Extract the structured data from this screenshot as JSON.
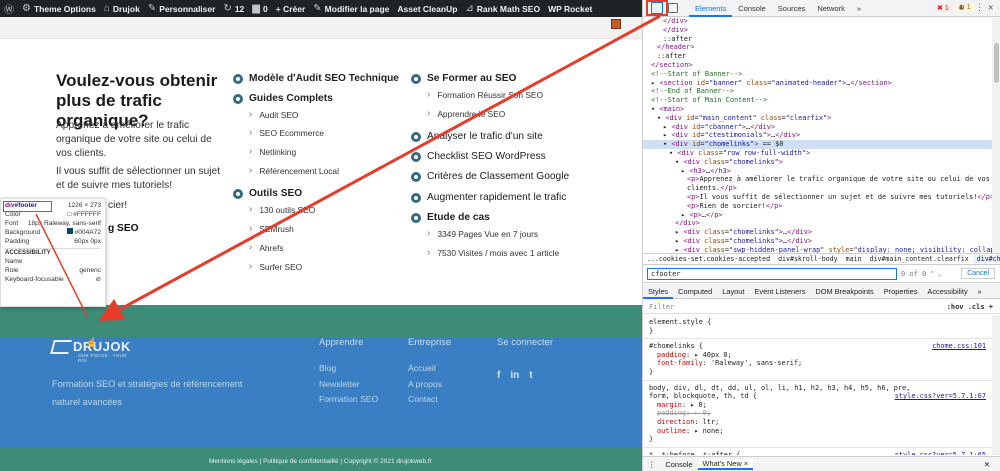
{
  "adminbar": {
    "items": [
      "Theme Options",
      "Drujok",
      "Personnaliser",
      "12",
      "0",
      "+ Créer",
      "Modifier la page",
      "Asset CleanUp",
      "Rank Math SEO",
      "WP Rocket"
    ]
  },
  "hero": {
    "title": "Voulez-vous obtenir plus de trafic organique?",
    "p1": "Apprenez à améliorer le trafic organique de votre site ou celui de vos clients.",
    "p2": "Il vous suffit de sélectionner un sujet et de suivre mes tutoriels!",
    "p3": "cier!",
    "p4": "g SEO"
  },
  "col1": {
    "b1": "Modèle d'Audit SEO Technique",
    "b2": "Guides Complets",
    "subs": [
      "Audit SEO",
      "SEO Ecommerce",
      "Netlinking",
      "Référencement Local"
    ],
    "b3": "Outils SEO",
    "subs2": [
      "130 outils SEO",
      "SEMrush",
      "Ahrefs",
      "Surfer SEO"
    ]
  },
  "col2": {
    "b1": "Se Former au SEO",
    "subs": [
      "Formation Réussir Son SEO",
      "Apprendre le SEO"
    ],
    "b2": "Analyser le trafic d'un site",
    "b3": "Checklist SEO WordPress",
    "b4": "Critères de Classement Google",
    "b5": "Augmenter rapidement le trafic",
    "b6": "Etude de cas",
    "subs2": [
      "3349 Pages Vue en 7 jours",
      "7530 Visites / mois avec 1 article"
    ]
  },
  "tooltip": {
    "selector_tag": "div",
    "selector_id": "#footer",
    "size": "1226 × 273",
    "rows": [
      {
        "k": "Color",
        "v": "#FFFFFF"
      },
      {
        "k": "Font",
        "v": "18px Raleway, sans-serif"
      },
      {
        "k": "Background",
        "v": "#004A72"
      },
      {
        "k": "Padding",
        "v": "60px 0px"
      }
    ],
    "section": "ACCESSIBILITY",
    "rows2": [
      {
        "k": "Name",
        "v": ""
      },
      {
        "k": "Role",
        "v": "generic"
      },
      {
        "k": "Keyboard-focusable",
        "v": "⊘"
      }
    ]
  },
  "footer": {
    "logo": "DRUJOK",
    "tagline": "OUR FOCUS · YOUR ROI",
    "desc1": "Formation SEO et stratégies de référencement",
    "desc2": "naturel avancées",
    "h_apprendre": "Apprendre",
    "apprendre": [
      "Blog",
      "Newsletter",
      "Formation SEO"
    ],
    "h_entreprise": "Entreprise",
    "entreprise": [
      "Accueil",
      "A propos",
      "Contact"
    ],
    "h_connect": "Se connecter",
    "socials": [
      "f",
      "in",
      "t"
    ],
    "legal": "Mentions légales  |  Politique de confidentialité  |  Copyright © 2021 drujokweb.fr"
  },
  "devtools": {
    "tabs": [
      "Elements",
      "Console",
      "Sources",
      "Network",
      "»"
    ],
    "errors": "1",
    "warnings": "1",
    "dom": [
      {
        "i": 20,
        "h": "<span class='tag'>&lt;/div&gt;</span>"
      },
      {
        "i": 20,
        "h": "<span class='tag'>&lt;/div&gt;</span>"
      },
      {
        "i": 20,
        "h": "::after"
      },
      {
        "i": 14,
        "h": "<span class='tag'>&lt;/header&gt;</span>"
      },
      {
        "i": 14,
        "h": "::after"
      },
      {
        "i": 8,
        "h": "<span class='tag'>&lt;/section&gt;</span>"
      },
      {
        "i": 8,
        "h": "<span class='cm'>&lt;!--Start of Banner--&gt;</span>"
      },
      {
        "i": 8,
        "h": "▸ <span class='tag'>&lt;section</span> <span class='an'>id</span>=<span class='av'>\"banner\"</span> <span class='an'>class</span>=<span class='av'>\"animated-header\"</span><span class='tag'>&gt;</span>…<span class='tag'>&lt;/section&gt;</span>"
      },
      {
        "i": 8,
        "h": "<span class='cm'>&lt;!--End of Banner--&gt;</span>"
      },
      {
        "i": 8,
        "h": "<span class='cm'>&lt;!--Start of Main Content--&gt;</span>"
      },
      {
        "i": 8,
        "h": "▾ <span class='tag'>&lt;main&gt;</span>"
      },
      {
        "i": 14,
        "h": "▾ <span class='tag'>&lt;div</span> <span class='an'>id</span>=<span class='av'>\"main_content\"</span> <span class='an'>class</span>=<span class='av'>\"clearfix\"</span><span class='tag'>&gt;</span>"
      },
      {
        "i": 20,
        "h": "▸ <span class='tag'>&lt;div</span> <span class='an'>id</span>=<span class='av'>\"cbanner\"</span><span class='tag'>&gt;</span>…<span class='tag'>&lt;/div&gt;</span>"
      },
      {
        "i": 20,
        "h": "▸ <span class='tag'>&lt;div</span> <span class='an'>id</span>=<span class='av'>\"ctestimonials\"</span><span class='tag'>&gt;</span>…<span class='tag'>&lt;/div&gt;</span>"
      },
      {
        "i": 20,
        "h": "▾ <span class='tag'>&lt;div</span> <span class='an'>id</span>=<span class='av'>\"chomelinks\"</span><span class='tag'>&gt;</span> == $0",
        "hl": true
      },
      {
        "i": 26,
        "h": "▾ <span class='tag'>&lt;div</span> <span class='an'>class</span>=<span class='av'>\"row row-full-width\"</span><span class='tag'>&gt;</span>"
      },
      {
        "i": 32,
        "h": "▾ <span class='tag'>&lt;div</span> <span class='an'>class</span>=<span class='av'>\"chomelinks\"</span><span class='tag'>&gt;</span>"
      },
      {
        "i": 38,
        "h": "▸ <span class='tag'>&lt;h3&gt;</span>…<span class='tag'>&lt;/h3&gt;</span>"
      },
      {
        "i": 44,
        "h": "<span class='tag'>&lt;p&gt;</span>Apprenez à améliorer le trafic organique de votre site ou celui de vos"
      },
      {
        "i": 44,
        "h": "clients.<span class='tag'>&lt;/p&gt;</span>"
      },
      {
        "i": 44,
        "h": "<span class='tag'>&lt;p&gt;</span>Il vous suffit de sélectionner un sujet et de suivre mes tutoriels!<span class='tag'>&lt;/p&gt;</span>"
      },
      {
        "i": 44,
        "h": "<span class='tag'>&lt;p&gt;</span>Rien de sorcier!<span class='tag'>&lt;/p&gt;</span>"
      },
      {
        "i": 38,
        "h": "▸ <span class='tag'>&lt;p&gt;</span>…<span class='tag'>&lt;/p&gt;</span>"
      },
      {
        "i": 32,
        "h": "<span class='tag'>&lt;/div&gt;</span>"
      },
      {
        "i": 32,
        "h": "▸ <span class='tag'>&lt;div</span> <span class='an'>class</span>=<span class='av'>\"chomelinks\"</span><span class='tag'>&gt;</span>…<span class='tag'>&lt;/div&gt;</span>"
      },
      {
        "i": 32,
        "h": "▸ <span class='tag'>&lt;div</span> <span class='an'>class</span>=<span class='av'>\"chomelinks\"</span><span class='tag'>&gt;</span>…<span class='tag'>&lt;/div&gt;</span>"
      },
      {
        "i": 32,
        "h": "▸ <span class='tag'>&lt;div</span> <span class='an'>class</span>=<span class='av'>\"swp-hidden-panel-wrap\"</span> <span class='an'>style</span>=<span class='av'>\"display: none; visibility: collaps</span>"
      }
    ],
    "crumbs": [
      "...cookies-set.cookies-accepted",
      "div#skroll-body",
      "main",
      "div#main_content.clearfix",
      "div#chomelinks"
    ],
    "search_value": "cfooter",
    "search_count": "0 of 0",
    "cancel": "Cancel",
    "subtabs": [
      "Styles",
      "Computed",
      "Layout",
      "Event Listeners",
      "DOM Breakpoints",
      "Properties",
      "Accessibility",
      "»"
    ],
    "filter_placeholder": "Filter",
    "filter_right": ":hov  .cls  +",
    "drawer": [
      "Console",
      "What's New ×"
    ]
  }
}
